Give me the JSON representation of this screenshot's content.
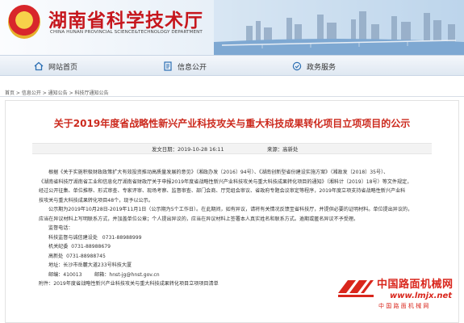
{
  "header": {
    "site_title": "湖南省科学技术厅",
    "site_subtitle": "CHINA HUNAN PROVINCIAL SCIENCE&TECHNOLOGY DEPARTMENT",
    "brand_color": "#c6161d"
  },
  "nav": {
    "items": [
      {
        "label": "网站首页",
        "icon": "home-icon"
      },
      {
        "label": "信息公开",
        "icon": "document-icon"
      },
      {
        "label": "政务服务",
        "icon": "service-icon"
      }
    ]
  },
  "breadcrumb": "首页 > 信息公开 > 通知公告 > 科技厅通知公告",
  "article": {
    "title": "关于2019年度省战略性新兴产业科技攻关与重大科技成果转化项目立项项目的公示",
    "publish_label": "发文日期：",
    "publish_date": "2019-10-28 16:11",
    "source_label": "来源：",
    "source": "高新处",
    "paragraphs": [
      "根据《关于实施积极财政政策扩大有效投资推动高质量发展的意见》（湘政办发〔2016〕94号）、《湖南创新型省份建设实施方案》（湘政发〔2018〕35号）、",
      "《湖南省科技厅湖南省工业和信息化厅湖南省财政厅关于申报2019年度省战略性新兴产业科技攻关与重大科技成果转化项目的通知》（湘科计〔2019〕18号）等文件规定，",
      "经过公开征集、单位推荐、形式审查、专家评审、现场考察、监督审查、部门会商、厅党组会审议、省政府专题会议审定等程序，2019年度立项支持省战略性新兴产业科",
      "技攻关与重大科技成果转化项目48个，现予以公示。",
      "公示期为2019年10月28日-2019年11月1日（公示期为5个工作日）。在此期间，如有异议，请将有关情况反馈至省科技厅，并提供必要的证明材料。单位提出异议的，",
      "应当在异议材料上写明联系方式，并加盖单位公章；个人提出异议的，应当在异议材料上签署本人真实姓名和联系方式。逾期或匿名异议不予受理。"
    ],
    "contact_heading": "监督电话：",
    "contacts": [
      {
        "label": "科技监督与诚信建设处",
        "phone": "0731-88988999"
      },
      {
        "label": "机关纪委",
        "phone": "0731-88988679"
      },
      {
        "label": "高新处",
        "phone": "0731-88988745"
      }
    ],
    "address": "地址：长沙市岳麓大道233号科技大厦",
    "postcode": "邮编：410013",
    "email": "邮箱：hnst-jg@hnst.gov.cn",
    "attachment": "附件：2019年度省战略性新兴产业科技攻关与重大科技成果转化项目立项项目清单"
  },
  "watermark": {
    "cn": "中国路面机械网",
    "url": "www.lmjx.net",
    "sub": "中 国 路 面 机 械 网",
    "color": "#d9261c"
  }
}
